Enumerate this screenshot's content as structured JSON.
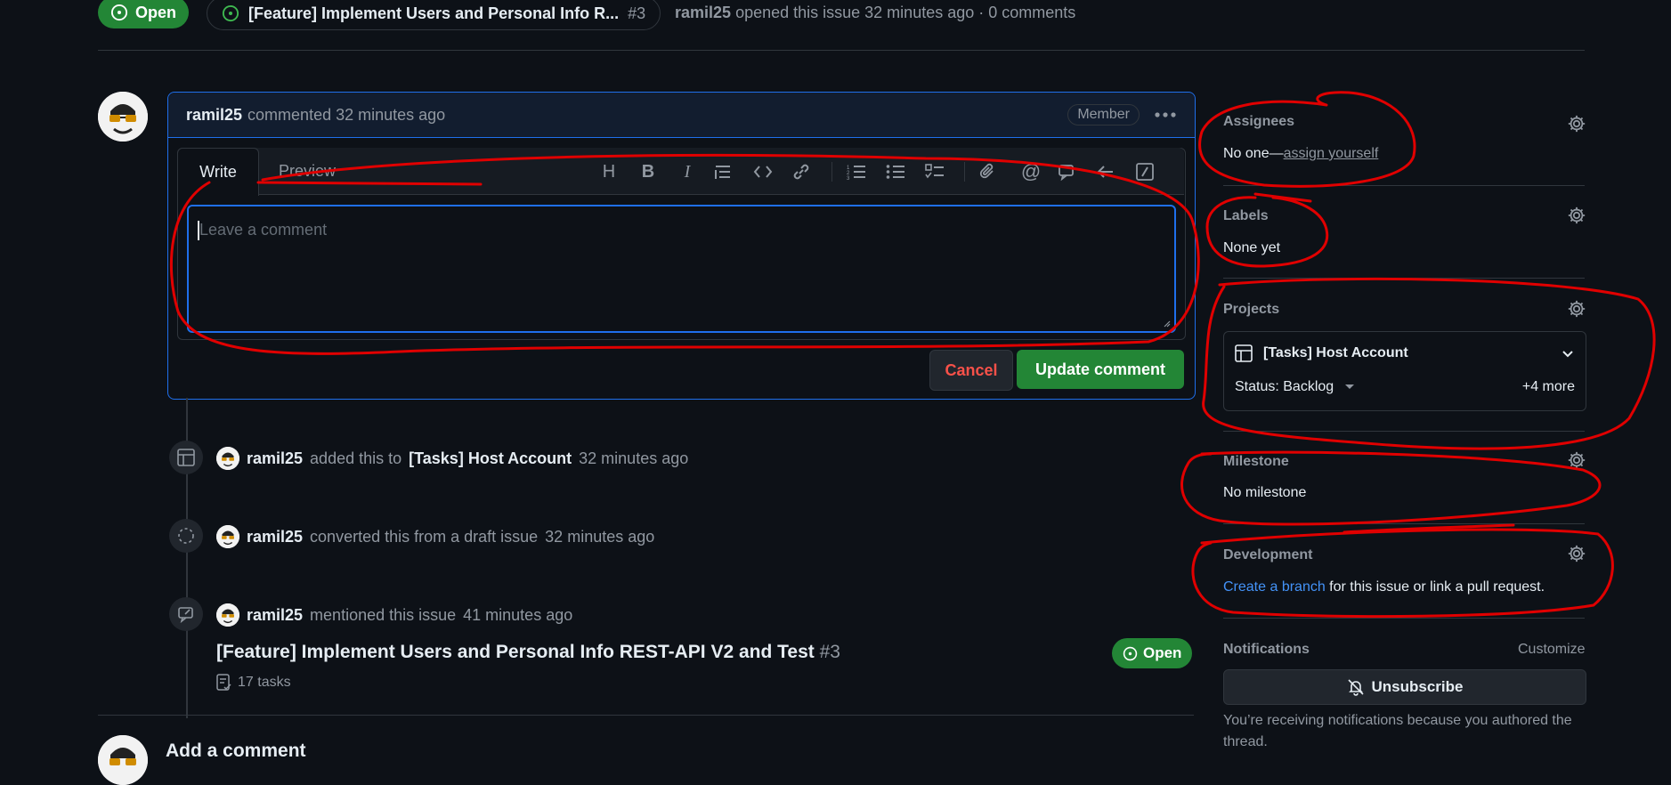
{
  "header": {
    "status_badge": "Open",
    "issue_title": "[Feature] Implement Users and Personal Info R...",
    "issue_number": "#3",
    "author": "ramil25",
    "meta": "opened this issue 32 minutes ago · 0 comments"
  },
  "comment": {
    "author": "ramil25",
    "action": "commented 32 minutes ago",
    "role": "Member",
    "tabs": {
      "write": "Write",
      "preview": "Preview"
    },
    "placeholder": "Leave a comment",
    "cancel_label": "Cancel",
    "update_label": "Update comment",
    "toolbar": [
      "H",
      "B",
      "I",
      "quote",
      "code",
      "link",
      "ordered-list",
      "unordered-list",
      "task-list",
      "attach",
      "mention",
      "reference",
      "undo",
      "slash"
    ]
  },
  "timeline": [
    {
      "user": "ramil25",
      "action": "added this to",
      "target": "[Tasks] Host Account",
      "time": "32 minutes ago"
    },
    {
      "user": "ramil25",
      "action": "converted this from a draft issue",
      "time": "32 minutes ago"
    },
    {
      "user": "ramil25",
      "action": "mentioned this issue",
      "time": "41 minutes ago"
    }
  ],
  "mention": {
    "title": "[Feature] Implement Users and Personal Info REST-API V2 and Test",
    "number": "#3",
    "tasks": "17 tasks",
    "status": "Open"
  },
  "add_comment": {
    "title": "Add a comment"
  },
  "sidebar": {
    "assignees": {
      "title": "Assignees",
      "none": "No one—",
      "assign": "assign yourself"
    },
    "labels": {
      "title": "Labels",
      "value": "None yet"
    },
    "projects": {
      "title": "Projects",
      "project": "[Tasks] Host Account",
      "status": "Status: Backlog",
      "more": "+4 more"
    },
    "milestone": {
      "title": "Milestone",
      "value": "No milestone"
    },
    "development": {
      "title": "Development",
      "link": "Create a branch",
      "rest": " for this issue or link a pull request."
    },
    "notifications": {
      "title": "Notifications",
      "customize": "Customize",
      "unsubscribe": "Unsubscribe",
      "note": "You’re receiving notifications because you authored the thread."
    }
  },
  "colors": {
    "accent": "#1f6feb",
    "open": "#238636",
    "annotation": "#e00000",
    "background": "#0d1117"
  }
}
